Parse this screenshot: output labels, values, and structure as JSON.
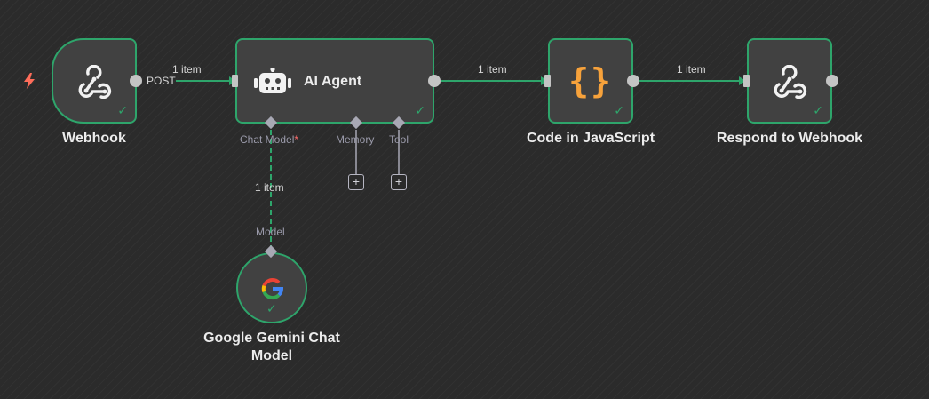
{
  "canvas": {
    "accent_color": "#2ea56b",
    "background_color": "#2b2b2b"
  },
  "nodes": {
    "webhook": {
      "title": "Webhook",
      "icon": "webhook-icon",
      "method": "POST",
      "trigger_icon": "lightning-bolt-icon"
    },
    "ai_agent": {
      "title": "AI Agent",
      "icon": "robot-icon",
      "ports": {
        "chat_model": "Chat Model",
        "chat_model_required": "*",
        "memory": "Memory",
        "tool": "Tool"
      }
    },
    "code": {
      "title": "Code in JavaScript",
      "icon": "curly-braces-icon",
      "icon_text": "{}",
      "icon_color": "#f7a23b"
    },
    "respond": {
      "title": "Respond to Webhook",
      "icon": "webhook-icon"
    },
    "gemini": {
      "title_line1": "Google Gemini Chat",
      "title_line2": "Model",
      "icon": "google-g-icon",
      "port_label": "Model"
    }
  },
  "connections": [
    {
      "from": "Webhook",
      "to": "AI Agent",
      "label": "1 item"
    },
    {
      "from": "AI Agent",
      "to": "Code in JavaScript",
      "label": "1 item"
    },
    {
      "from": "Code in JavaScript",
      "to": "Respond to Webhook",
      "label": "1 item"
    },
    {
      "from": "Google Gemini Chat Model",
      "to": "AI Agent",
      "label": "1 item"
    }
  ]
}
